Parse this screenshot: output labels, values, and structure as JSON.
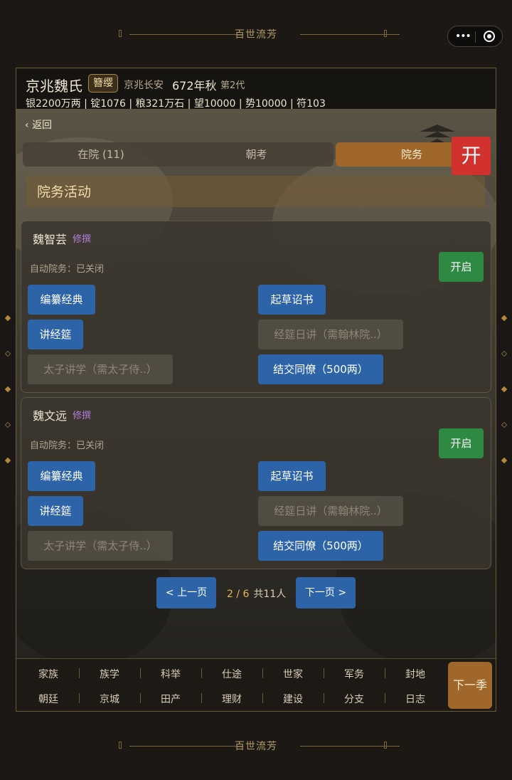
{
  "banner": {
    "title": "百世流芳"
  },
  "header": {
    "clan": "京兆魏氏",
    "badge": "簪缨",
    "place": "京兆长安",
    "year": "672年秋",
    "generation": "第2代",
    "stats": "银2200万两 | 锭1076 | 粮321万石 | 望10000 | 势10000 | 符103"
  },
  "nav_back": "返回",
  "tabs": [
    "在院 (11)",
    "朝考",
    "院务"
  ],
  "open_tag": "开",
  "section_title": "院务活动",
  "members": [
    {
      "name": "魏智芸",
      "role": "修撰",
      "auto": "自动院务：已关闭",
      "toggle": "开启",
      "actions": [
        {
          "label": "编纂经典",
          "enabled": true
        },
        {
          "label": "起草诏书",
          "enabled": true
        },
        {
          "label": "讲经筵",
          "enabled": true
        },
        {
          "label": "经筵日讲（需翰林院..）",
          "enabled": false
        },
        {
          "label": "太子讲学（需太子侍..）",
          "enabled": false
        },
        {
          "label": "结交同僚（500两）",
          "enabled": true
        }
      ]
    },
    {
      "name": "魏文远",
      "role": "修撰",
      "auto": "自动院务：已关闭",
      "toggle": "开启",
      "actions": [
        {
          "label": "编纂经典",
          "enabled": true
        },
        {
          "label": "起草诏书",
          "enabled": true
        },
        {
          "label": "讲经筵",
          "enabled": true
        },
        {
          "label": "经筵日讲（需翰林院..）",
          "enabled": false
        },
        {
          "label": "太子讲学（需太子侍..）",
          "enabled": false
        },
        {
          "label": "结交同僚（500两）",
          "enabled": true
        }
      ]
    }
  ],
  "pager": {
    "prev": "< 上一页",
    "page": "2 / 6",
    "total": "共11人",
    "next": "下一页 >"
  },
  "bottom_nav": {
    "row1": [
      "家族",
      "族学",
      "科举",
      "仕途",
      "世家",
      "军务",
      "封地"
    ],
    "row2": [
      "朝廷",
      "京城",
      "田产",
      "理财",
      "建设",
      "分支",
      "日志"
    ],
    "next_season": "下一季"
  },
  "colors": {
    "accent": "#a0672a",
    "action_blue": "#2d64a8",
    "toggle_green": "#2e8a42",
    "open_red": "#d1322d",
    "role_purple": "#b67fe0"
  }
}
